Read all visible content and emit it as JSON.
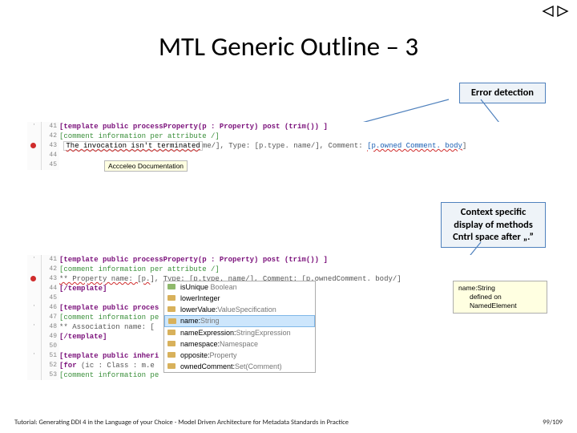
{
  "title": "MTL Generic Outline – 3",
  "callouts": {
    "error": "Error detection",
    "context_l1": "Context specific",
    "context_l2": "display of methods",
    "context_l3": "Cntrl space after „.”"
  },
  "block1": {
    "l41": "41",
    "l42": "42",
    "l43": "43",
    "l44": "44",
    "l45": "45",
    "tmpl_kw": "[template public ",
    "tmpl_sig": "processProperty(p : Property) post (trim()) ]",
    "cmt": "[comment information per attribute /]",
    "err_head": "The invocation isn't terminated",
    "err_tail_1": "me/], Type: [p.type. name/], Comment: ",
    "err_tail_2": "[p.owned Comment. body",
    "err_tail_3": "]",
    "tooltip": "Accceleo Documentation"
  },
  "block2": {
    "l41": "41",
    "l42": "42",
    "l43": "43",
    "l44": "44",
    "l45": "45",
    "l46": "46",
    "l47": "47",
    "l48": "48",
    "l49": "49",
    "l50": "50",
    "l51": "51",
    "l52": "52",
    "l53": "53",
    "ln41_kw": "[template public ",
    "ln41_sig": "processProperty(p : Property) post (trim()) ]",
    "ln42": "[comment information per attribute /]",
    "ln43_a": "** Property name: [p.",
    "ln43_b": "], Type: [p.type. name/], Comment: [p.ownedComment. body/]",
    "ln44": "[/template]",
    "ln46_kw": "[template public ",
    "ln46_sig": "proces",
    "ln47": "[comment information pe",
    "ln48": "** Association name: [",
    "ln49": "[/template]",
    "ln51_kw": "[template public ",
    "ln51_sig": "inheri",
    "ln52_a": "[for ",
    "ln52_b": "(ic : Class : m.e",
    "ln53": "[comment information pe"
  },
  "popup": {
    "i1a": "isUnique",
    "i1b": "Boolean",
    "i2a": "lowerInteger",
    "i3a": "lowerValue:",
    "i3b": "ValueSpecification",
    "i4a": "name:",
    "i4b": "String",
    "i5a": "nameExpression:",
    "i5b": "StringExpression",
    "i6a": "namespace:",
    "i6b": "Namespace",
    "i7a": "opposite:",
    "i7b": "Property",
    "i8a": "ownedComment:",
    "i8b": "Set(Comment)"
  },
  "infobox": {
    "l1": "name:String",
    "l2": "defined on NamedElement"
  },
  "footer": {
    "left": "Tutorial: Generating DDI 4 in the Language of your Choice -  Model Driven Architecture for Metadata Standards in Practice",
    "right": "99/109"
  }
}
